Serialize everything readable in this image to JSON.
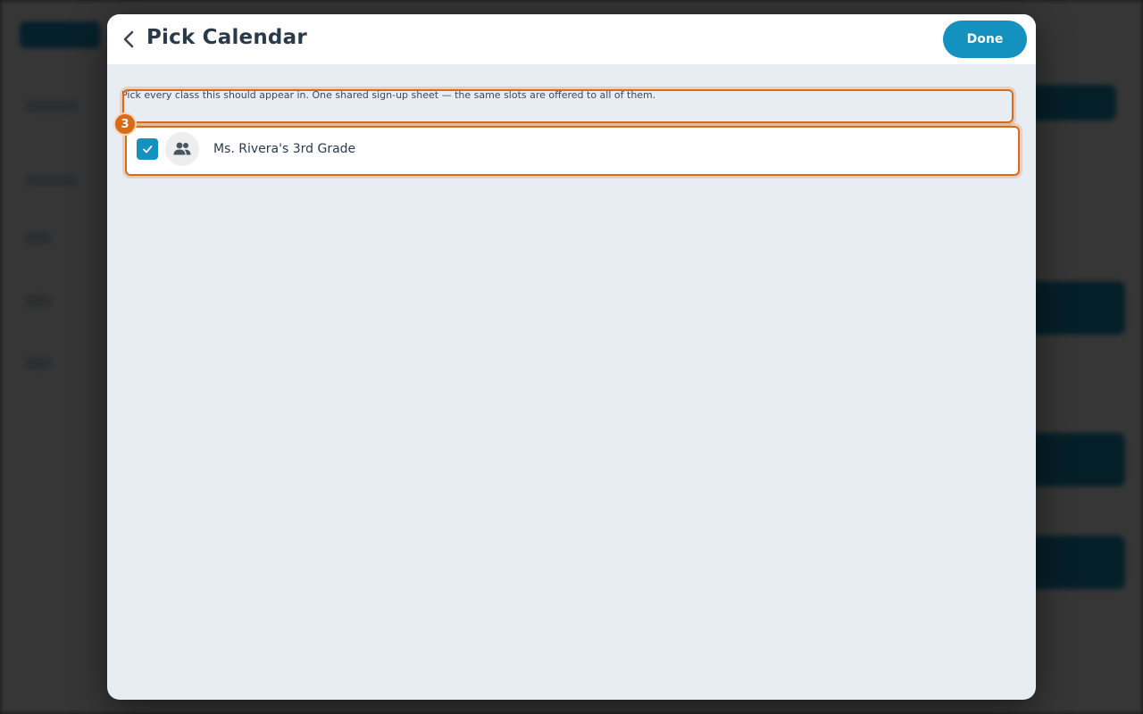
{
  "modal": {
    "title": "Pick Calendar",
    "done_label": "Done",
    "helper_text": "Pick every class this should appear in. One shared sign-up sheet — the same slots are offered to all of them.",
    "step_badge": "3"
  },
  "calendars": [
    {
      "name": "Ms. Rivera's 3rd Grade",
      "checked": true,
      "icon": "group-icon"
    }
  ],
  "colors": {
    "accent": "#1591bf",
    "highlight": "#d96a16",
    "modal_bg": "#e8edf3",
    "title": "#2a3a4a"
  }
}
